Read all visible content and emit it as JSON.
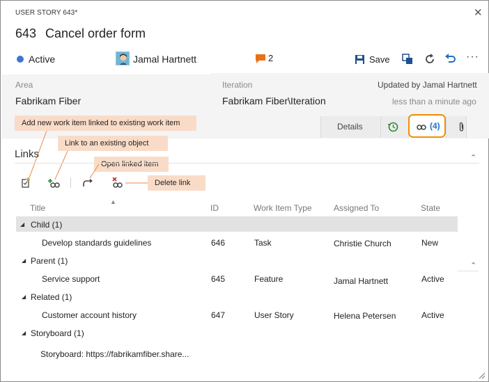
{
  "header": {
    "work_item_type": "USER STORY 643*",
    "id": "643",
    "title": "Cancel order form",
    "state": "Active",
    "assignee": "Jamal Hartnett",
    "discussion_count": "2",
    "save_label": "Save"
  },
  "fields": {
    "area_label": "Area",
    "area_value": "Fabrikam Fiber",
    "iteration_label": "Iteration",
    "iteration_value": "Fabrikam Fiber\\Iteration",
    "updated_by": "Updated by Jamal Hartnett",
    "updated_time": "less than a minute ago"
  },
  "tabs": {
    "details": "Details",
    "links_count": "(4)"
  },
  "callouts": {
    "add_new": "Add new work item linked to existing work item",
    "link_existing": "Link to an existing object",
    "open_linked": "Open linked item",
    "delete_link": "Delete link"
  },
  "links": {
    "heading": "Links",
    "columns": [
      "Title",
      "ID",
      "Work Item Type",
      "Assigned To",
      "State"
    ],
    "groups": [
      {
        "label": "Child (1)",
        "rows": [
          {
            "title": "Develop standards guidelines",
            "id": "646",
            "type": "Task",
            "assigned": "Christie Church",
            "state": "New"
          }
        ]
      },
      {
        "label": "Parent (1)",
        "rows": [
          {
            "title": "Service support",
            "id": "645",
            "type": "Feature",
            "assigned": "Jamal Hartnett",
            "state": "Active"
          }
        ]
      },
      {
        "label": "Related (1)",
        "rows": [
          {
            "title": "Customer account history",
            "id": "647",
            "type": "User Story",
            "assigned": "Helena Petersen",
            "state": "Active"
          }
        ]
      },
      {
        "label": "Storyboard (1)",
        "rows": [
          {
            "title": "Storyboard: https://fabrikamfiber.share..."
          }
        ]
      }
    ]
  },
  "colors": {
    "accent_blue": "#1f6fc5",
    "state_active": "#3f75d0",
    "highlight_orange": "#f0900a",
    "callout_bg": "#f9dcc8"
  }
}
